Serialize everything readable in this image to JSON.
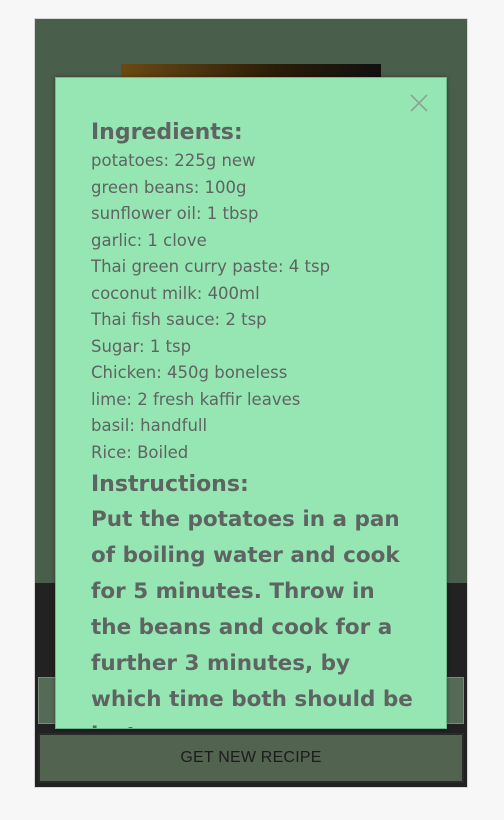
{
  "modal": {
    "ingredients_heading": "Ingredients:",
    "ingredients": [
      "potatoes: 225g new",
      "green beans: 100g",
      "sunflower oil: 1 tbsp",
      "garlic: 1 clove",
      "Thai green curry paste: 4 tsp",
      "coconut milk: 400ml",
      "Thai fish sauce: 2 tsp",
      "Sugar: 1 tsp",
      "Chicken: 450g boneless",
      "lime: 2 fresh kaffir leaves",
      "basil: handfull",
      "Rice: Boiled"
    ],
    "instructions_heading": "Instructions:",
    "instructions_text": "Put the potatoes in a pan of boiling water and cook for 5 minutes. Throw in the beans and cook for a further 3 minutes, by which time both should be just"
  },
  "footer": {
    "get_recipe_label": "GET NEW RECIPE"
  },
  "icons": {
    "close": "close-icon"
  },
  "colors": {
    "modal_bg": "#96e6b3",
    "app_bg": "#4a5e4c",
    "text": "#5e6461"
  }
}
